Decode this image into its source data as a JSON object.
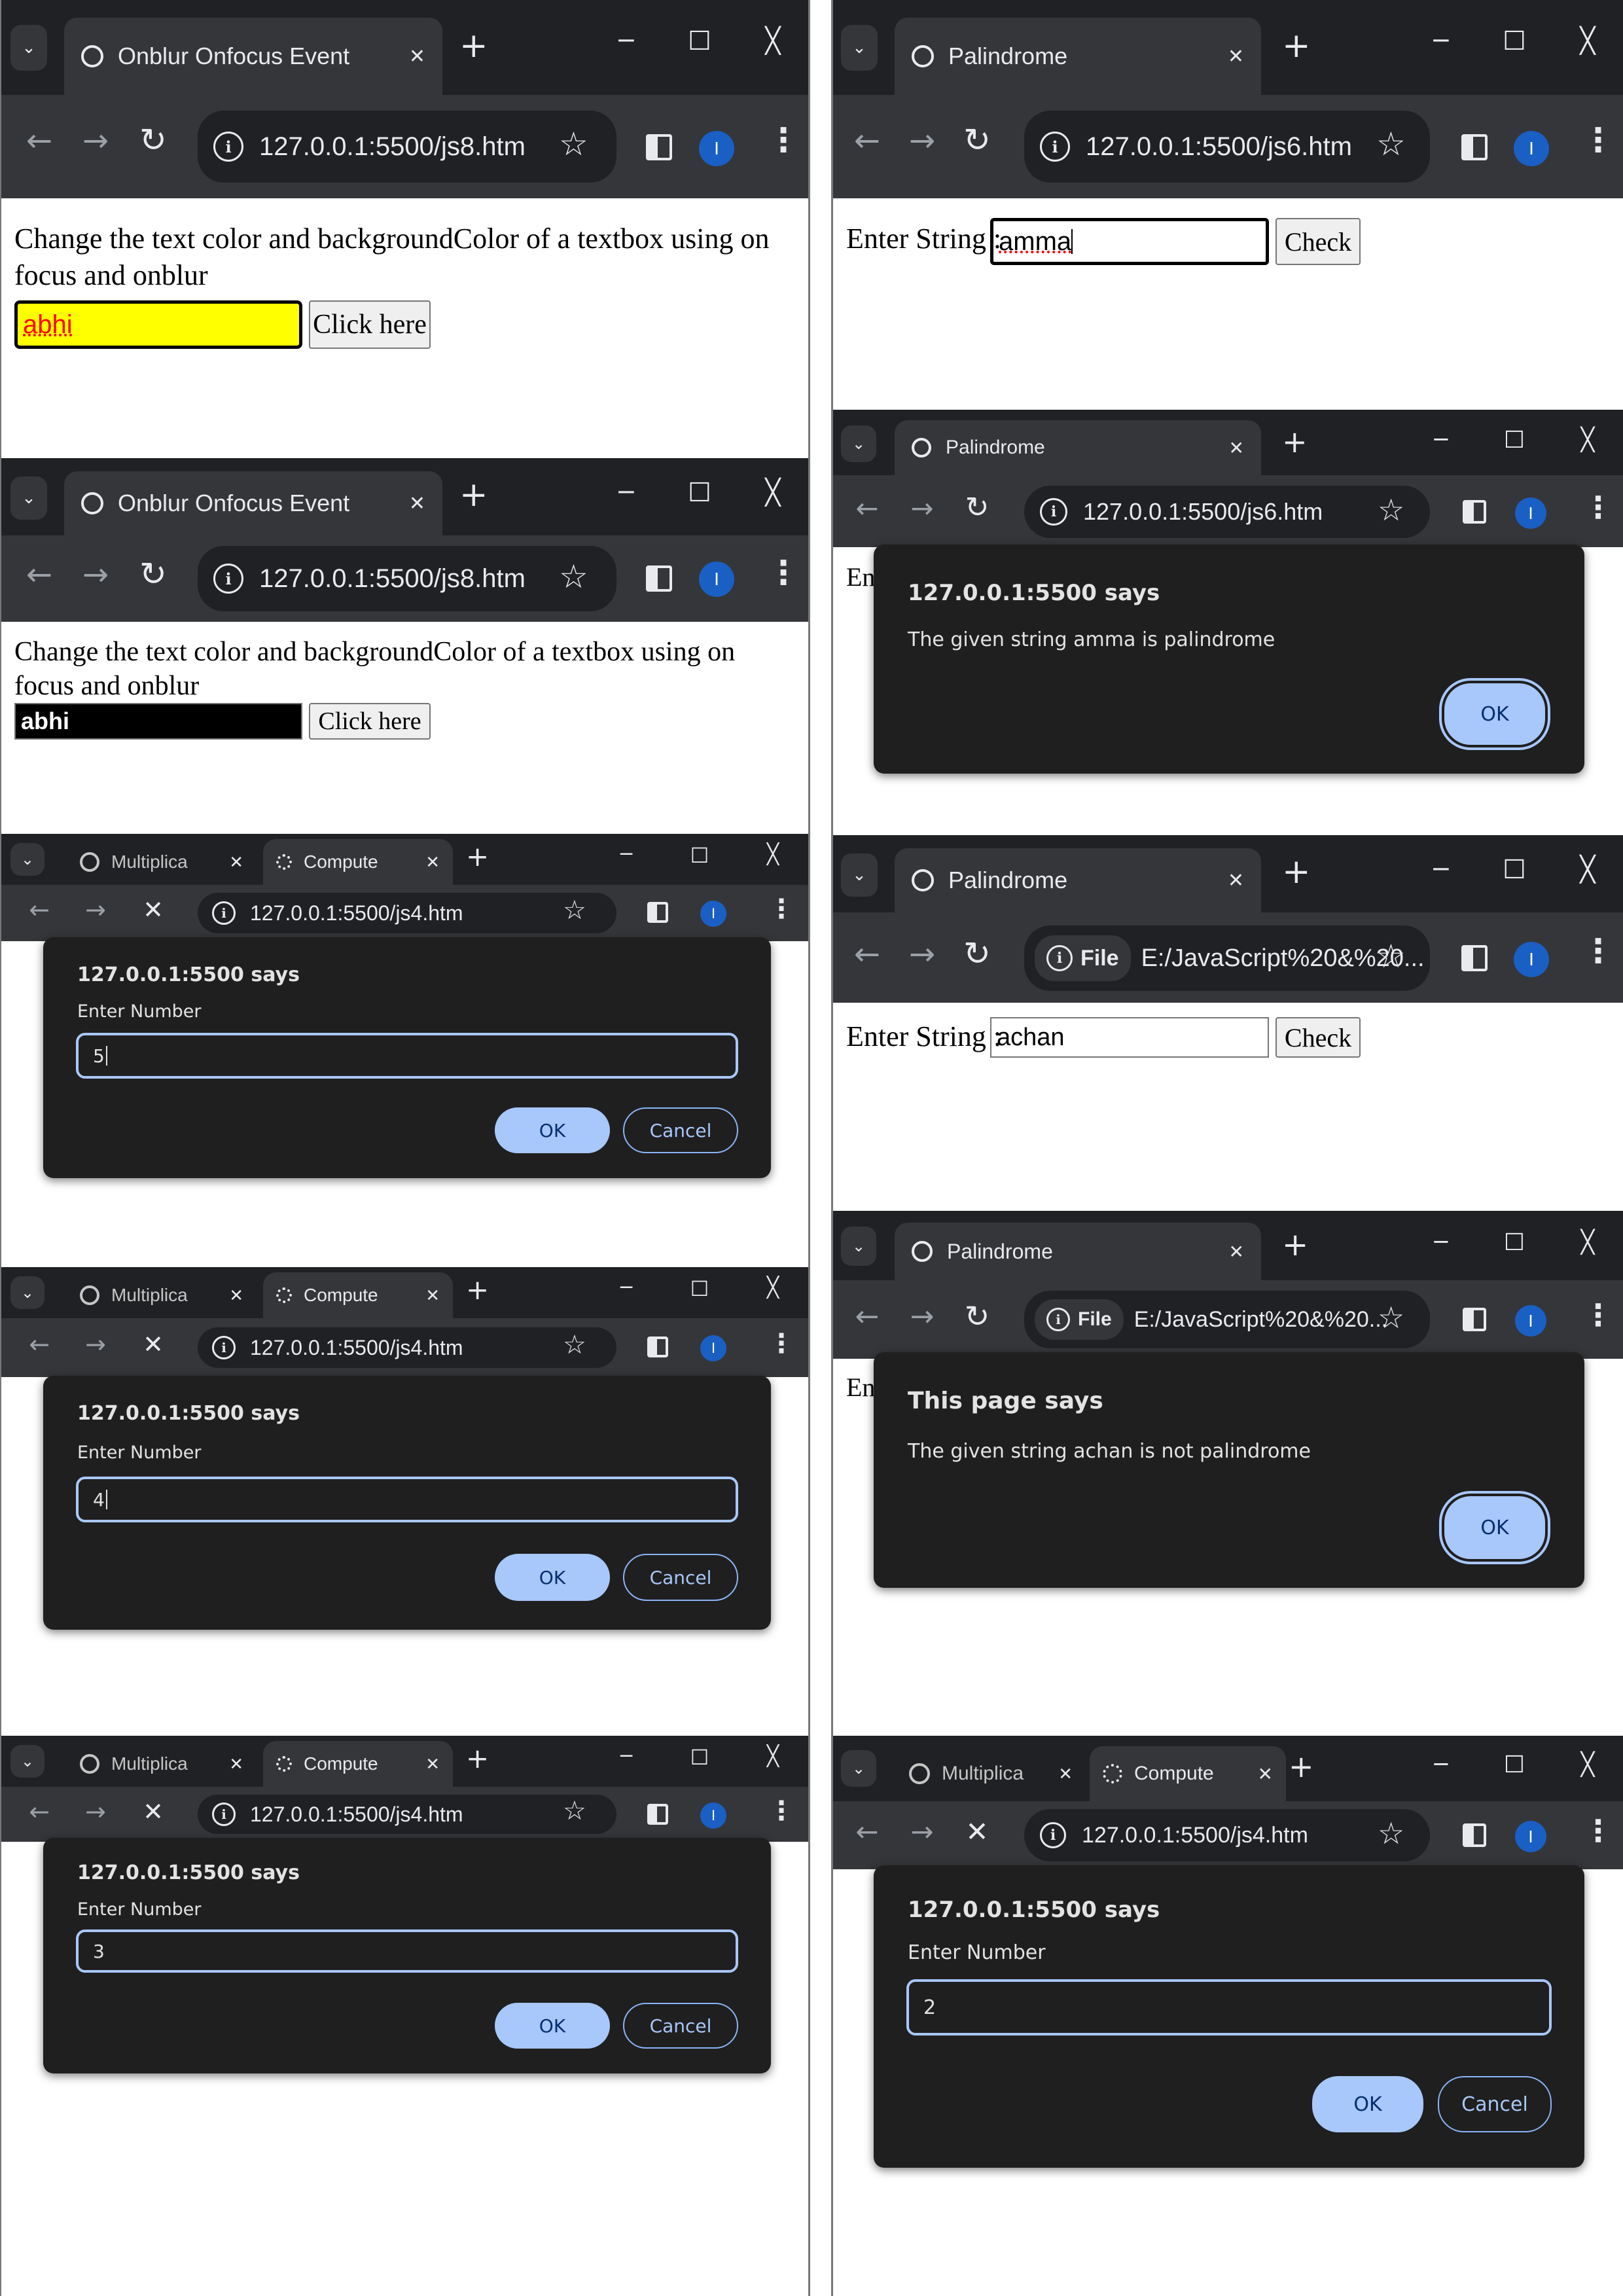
{
  "browser": {
    "minimize": "─",
    "maximize": "☐",
    "close": "╳",
    "new_tab": "+",
    "avatar_letter": "I"
  },
  "focus": {
    "tab_title": "Onblur Onfocus Event",
    "url": "127.0.0.1:5500/js8.htm",
    "description": "Change the text color and backgroundColor of a textbox using on focus and onblur",
    "button_label": "Click here",
    "focused": {
      "value": "abhi",
      "text_color": "#ff0000",
      "background": "#ffff00"
    },
    "blurred": {
      "value": "abhi",
      "text_color": "#ffffff",
      "background": "#000000"
    }
  },
  "palindrome": {
    "tab_title": "Palindrome",
    "url": "127.0.0.1:5500/js6.htm",
    "file_chip": "File",
    "file_url": "E:/JavaScript%20&%20...",
    "label": "Enter String :",
    "button_label": "Check",
    "cut_label": "En",
    "input_1": "amma",
    "input_2": "achan",
    "alert_1": {
      "title": "127.0.0.1:5500 says",
      "message": "The given string amma is palindrome",
      "ok": "OK"
    },
    "alert_2": {
      "title": "This page says",
      "message": "The given string achan is not palindrome",
      "ok": "OK"
    }
  },
  "prompt": {
    "tab_1": "Multiplica",
    "tab_2": "Compute",
    "url": "127.0.0.1:5500/js4.htm",
    "title": "127.0.0.1:5500 says",
    "message": "Enter Number",
    "ok": "OK",
    "cancel": "Cancel",
    "values": [
      "5",
      "4",
      "3",
      "2"
    ]
  },
  "colors": {
    "tabbar": "#202124",
    "toolbar": "#35363a",
    "dialog": "#1f1f1f",
    "accent": "#a8c7fa",
    "avatar": "#1a5fc4"
  }
}
